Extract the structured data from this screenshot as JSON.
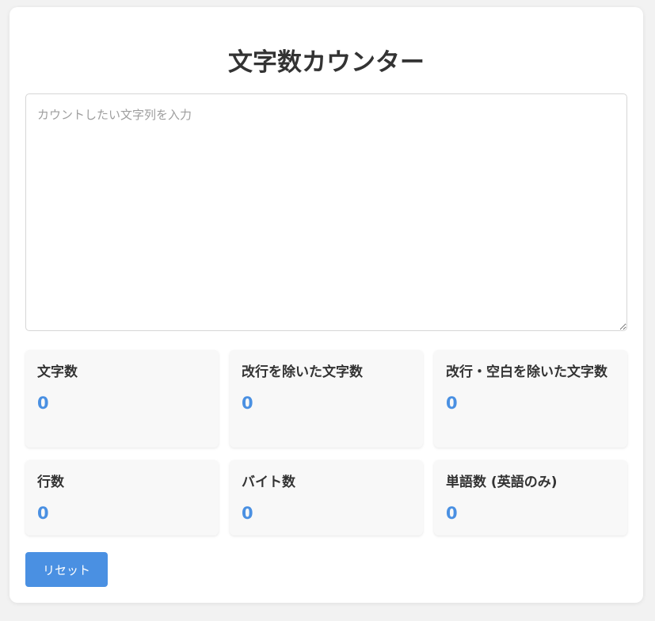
{
  "app": {
    "title": "文字数カウンター"
  },
  "input": {
    "placeholder": "カウントしたい文字列を入力",
    "value": ""
  },
  "stats": [
    {
      "label": "文字数",
      "value": "0"
    },
    {
      "label": "改行を除いた文字数",
      "value": "0"
    },
    {
      "label": "改行・空白を除いた文字数",
      "value": "0"
    },
    {
      "label": "行数",
      "value": "0"
    },
    {
      "label": "バイト数",
      "value": "0"
    },
    {
      "label": "単語数 (英語のみ)",
      "value": "0"
    }
  ],
  "actions": {
    "reset_label": "リセット"
  },
  "colors": {
    "accent": "#4a90e2",
    "background": "#f2f2f2",
    "card": "#ffffff",
    "stat_card": "#f8f8f8",
    "text": "#333333"
  }
}
